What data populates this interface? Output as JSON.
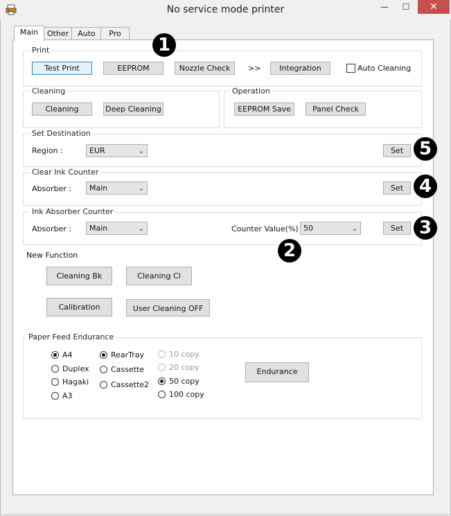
{
  "window": {
    "title": "No service mode printer",
    "minimize": "—",
    "maximize": "☐",
    "close": "✕"
  },
  "tabs": [
    "Main",
    "Other",
    "Auto",
    "Pro"
  ],
  "print_group": {
    "title": "Print",
    "test_print": "Test Print",
    "eeprom": "EEPROM",
    "nozzle_check": "Nozzle Check",
    "arrow": ">>",
    "integration": "Integration",
    "auto_cleaning": "Auto Cleaning"
  },
  "cleaning_group": {
    "title": "Cleaning",
    "cleaning": "Cleaning",
    "deep_cleaning": "Deep Cleaning"
  },
  "operation_group": {
    "title": "Operation",
    "eeprom_save": "EEPROM Save",
    "panel_check": "Panel Check"
  },
  "destination_group": {
    "title": "Set Destination",
    "region_label": "Region :",
    "region_value": "EUR",
    "set": "Set"
  },
  "clear_ink_group": {
    "title": "Clear Ink Counter",
    "absorber_label": "Absorber :",
    "absorber_value": "Main",
    "set": "Set"
  },
  "ink_absorber_group": {
    "title": "Ink Absorber Counter",
    "absorber_label": "Absorber :",
    "absorber_value": "Main",
    "counter_label": "Counter Value(%) :",
    "counter_value": "50",
    "set": "Set"
  },
  "new_function": {
    "title": "New Function",
    "cleaning_bk": "Cleaning Bk",
    "cleaning_cl": "Cleaning Cl",
    "calibration": "Calibration",
    "user_cleaning_off": "User Cleaning OFF"
  },
  "paper_feed": {
    "title": "Paper Feed Endurance",
    "sizes": [
      "A4",
      "Duplex",
      "Hagaki",
      "A3"
    ],
    "selected_size": "A4",
    "trays": [
      "RearTray",
      "Cassette",
      "Cassette2"
    ],
    "selected_tray": "RearTray",
    "copies": [
      "10 copy",
      "20 copy",
      "50 copy",
      "100 copy"
    ],
    "selected_copy": "50 copy",
    "endurance": "Endurance"
  },
  "badges": [
    "1",
    "2",
    "3",
    "4",
    "5"
  ]
}
